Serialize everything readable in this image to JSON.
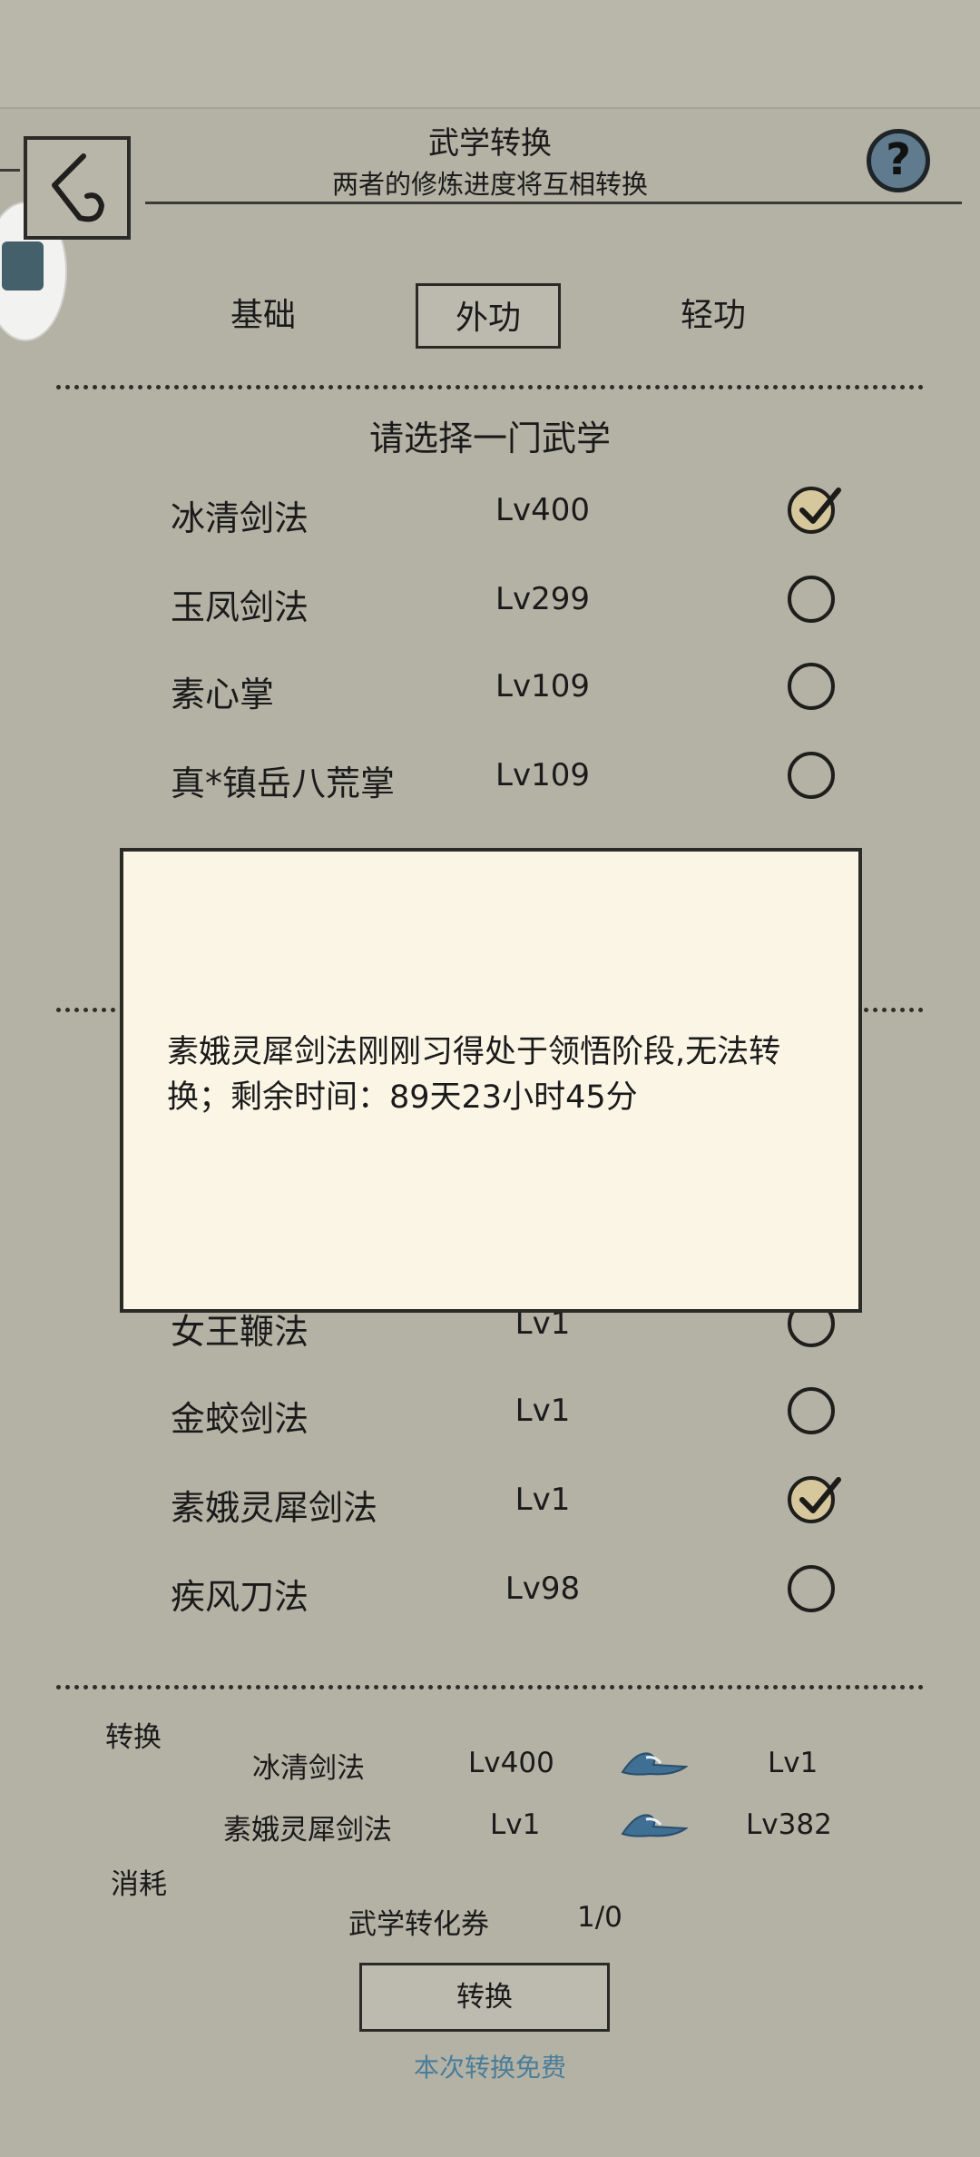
{
  "header": {
    "title": "武学转换",
    "subtitle": "两者的修炼进度将互相转换",
    "help_symbol": "?",
    "back_icon": "back-chevron-icon"
  },
  "tabs": [
    {
      "label": "基础",
      "selected": false
    },
    {
      "label": "外功",
      "selected": true
    },
    {
      "label": "轻功",
      "selected": false
    }
  ],
  "list": {
    "title": "请选择一门武学",
    "items": [
      {
        "name": "冰清剑法",
        "level": "Lv400",
        "checked": true
      },
      {
        "name": "玉凤剑法",
        "level": "Lv299",
        "checked": false
      },
      {
        "name": "素心掌",
        "level": "Lv109",
        "checked": false
      },
      {
        "name": "真*镇岳八荒掌",
        "level": "Lv109",
        "checked": false
      }
    ]
  },
  "list2": {
    "items": [
      {
        "name": "女王鞭法",
        "level": "Lv1",
        "checked": false
      },
      {
        "name": "金蛟剑法",
        "level": "Lv1",
        "checked": false
      },
      {
        "name": "素娥灵犀剑法",
        "level": "Lv1",
        "checked": true
      },
      {
        "name": "疾风刀法",
        "level": "Lv98",
        "checked": false
      }
    ]
  },
  "modal": {
    "message": "素娥灵犀剑法刚刚习得处于领悟阶段,无法转换；剩余时间：89天23小时45分"
  },
  "conversion": {
    "label": "转换",
    "rows": [
      {
        "name": "冰清剑法",
        "from": "Lv400",
        "to": "Lv1"
      },
      {
        "name": "素娥灵犀剑法",
        "from": "Lv1",
        "to": "Lv382"
      }
    ],
    "cost_label": "消耗",
    "cost_item": "武学转化券",
    "cost_value": "1/0",
    "button_label": "转换",
    "free_note": "本次转换免费"
  },
  "colors": {
    "background": "#b4b2a5",
    "modal_bg": "#fbf5e6",
    "help_button": "#5f7b8d",
    "check_fill": "#d6c79c",
    "free_note": "#4a7d99",
    "arrow_blue": "#3f6f93"
  }
}
